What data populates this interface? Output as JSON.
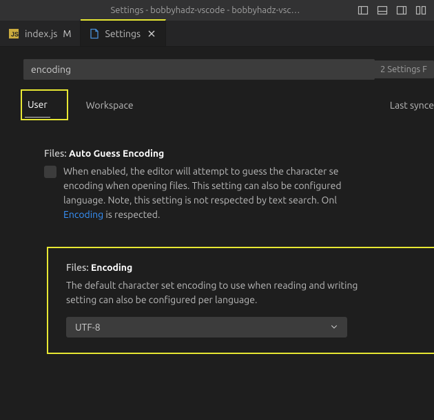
{
  "title": "Settings - bobbyhadz-vscode - bobbyhadz-vsc…",
  "tabs": [
    {
      "label": "index.js",
      "dirty": "M"
    },
    {
      "label": "Settings"
    }
  ],
  "search": {
    "value": "encoding",
    "count_label": "2 Settings F"
  },
  "scopes": {
    "user": "User",
    "workspace": "Workspace",
    "sync": "Last synce"
  },
  "settings": {
    "autoGuess": {
      "category": "Files:",
      "name": "Auto Guess Encoding",
      "desc_a": "When enabled, the editor will attempt to guess the character se",
      "desc_b": "encoding when opening files. This setting can also be configured",
      "desc_c": "language. Note, this setting is not respected by text search. Onl",
      "desc_link": "Encoding",
      "desc_d": " is respected."
    },
    "encoding": {
      "category": "Files:",
      "name": "Encoding",
      "desc_a": "The default character set encoding to use when reading and writing",
      "desc_b": "setting can also be configured per language.",
      "value": "UTF-8"
    }
  }
}
